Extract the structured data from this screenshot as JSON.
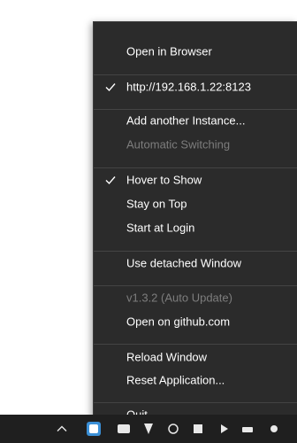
{
  "menu": {
    "items": [
      {
        "label": "Open in Browser",
        "checked": false,
        "enabled": true
      },
      {
        "label": "http://192.168.1.22:8123",
        "checked": true,
        "enabled": true
      },
      {
        "label": "Add another Instance...",
        "checked": false,
        "enabled": true
      },
      {
        "label": "Automatic Switching",
        "checked": false,
        "enabled": false
      },
      {
        "label": "Hover to Show",
        "checked": true,
        "enabled": true
      },
      {
        "label": "Stay on Top",
        "checked": false,
        "enabled": true
      },
      {
        "label": "Start at Login",
        "checked": false,
        "enabled": true
      },
      {
        "label": "Use detached Window",
        "checked": false,
        "enabled": true
      },
      {
        "label": "v1.3.2 (Auto Update)",
        "checked": false,
        "enabled": false
      },
      {
        "label": "Open on github.com",
        "checked": false,
        "enabled": true
      },
      {
        "label": "Reload Window",
        "checked": false,
        "enabled": true
      },
      {
        "label": "Reset Application...",
        "checked": false,
        "enabled": true
      },
      {
        "label": "Quit",
        "checked": false,
        "enabled": true
      }
    ]
  },
  "taskbar": {
    "icons": [
      "chevron-up-icon",
      "app-tray-icon",
      "tray-icon",
      "tray-icon",
      "tray-icon",
      "tray-icon",
      "tray-icon",
      "tray-icon"
    ]
  },
  "colors": {
    "menu_bg": "#2b2b2b",
    "separator": "#444444",
    "disabled_text": "#7d7d7d",
    "taskbar_bg": "#1f1f1f"
  }
}
